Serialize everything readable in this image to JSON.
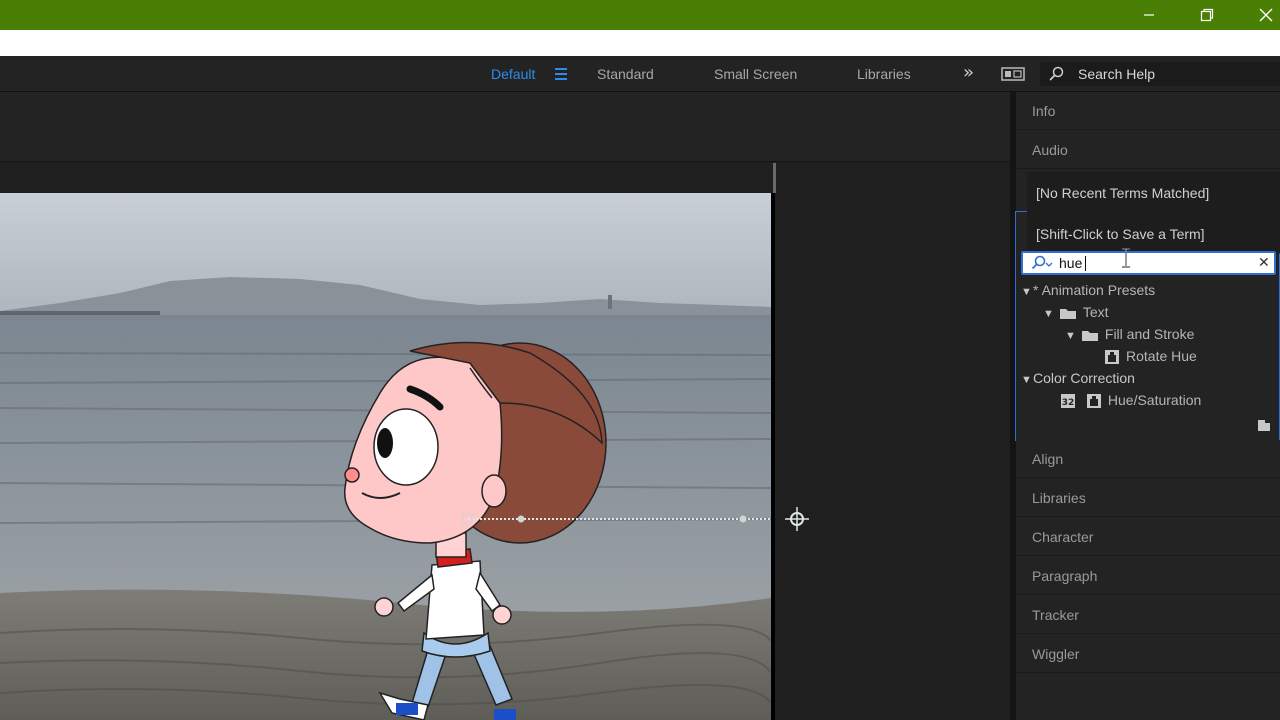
{
  "window": {
    "titlebar_color": "#4a7f05",
    "controls": [
      "minimize-icon",
      "restore-icon",
      "close-icon"
    ]
  },
  "workspaces": {
    "items": [
      "Default",
      "Standard",
      "Small Screen",
      "Libraries"
    ],
    "active": "Default",
    "accent_color": "#2d8ceb"
  },
  "search_help": {
    "placeholder": "Search Help"
  },
  "panels": {
    "tabs_top": [
      "Info",
      "Audio"
    ],
    "tabs_bottom": [
      "Align",
      "Libraries",
      "Character",
      "Paragraph",
      "Tracker",
      "Wiggler"
    ]
  },
  "effects_presets": {
    "recent_terms": [
      "[No Recent Terms Matched]",
      "[Shift-Click to Save a Term]"
    ],
    "search_value": "hue",
    "tree": {
      "animation_presets": "* Animation Presets",
      "text": "Text",
      "fill_and_stroke": "Fill and Stroke",
      "rotate_hue": "Rotate Hue",
      "color_correction": "Color Correction",
      "hue_saturation": "Hue/Saturation"
    },
    "bit_badge": "32"
  }
}
